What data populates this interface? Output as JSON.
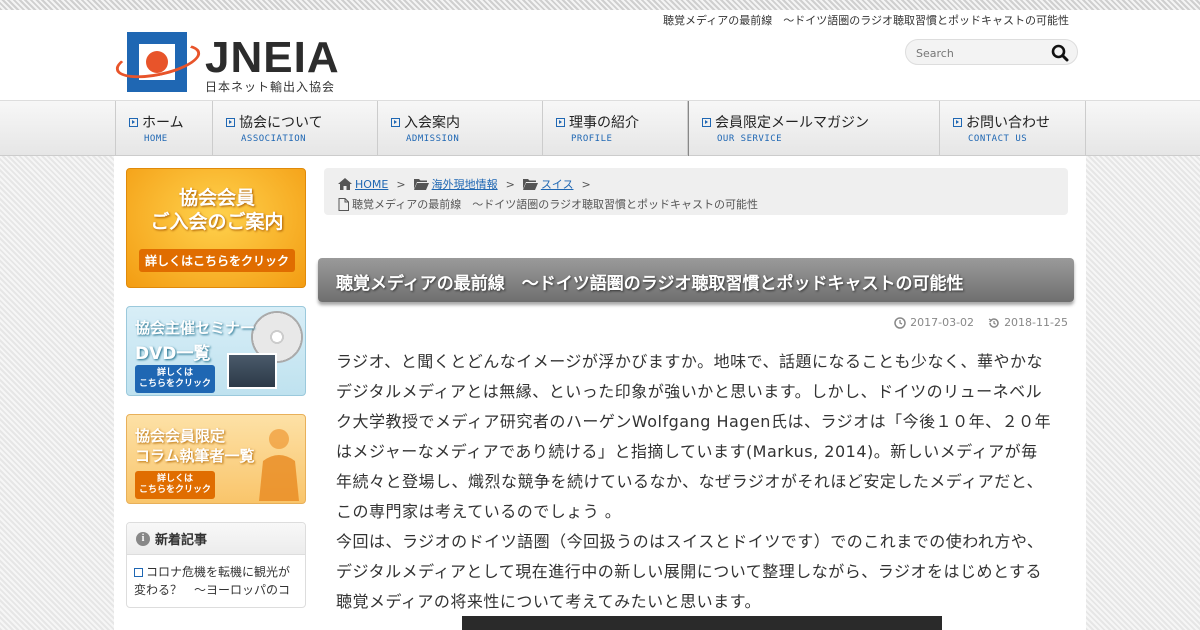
{
  "header": {
    "tagline": "聴覚メディアの最前線　〜ドイツ語圏のラジオ聴取習慣とポッドキャストの可能性",
    "logo_text": "JNEIA",
    "logo_subtitle": "日本ネット輸出入協会",
    "search": {
      "placeholder": "Search"
    }
  },
  "nav": {
    "items": [
      {
        "label": "ホーム",
        "en": "HOME"
      },
      {
        "label": "協会について",
        "en": "ASSOCIATION"
      },
      {
        "label": "入会案内",
        "en": "ADMISSION"
      },
      {
        "label": "理事の紹介",
        "en": "PROFILE"
      },
      {
        "label": "会員限定メールマガジン",
        "en": "OUR SERVICE"
      },
      {
        "label": "お問い合わせ",
        "en": "CONTACT US"
      }
    ]
  },
  "sidebar": {
    "banner1": {
      "line1": "協会会員",
      "line2": "ご入会のご案内",
      "cta": "詳しくはこちらをクリック"
    },
    "banner2": {
      "line1": "協会主催セミナー",
      "line2": "DVD一覧",
      "cta1": "詳しくは",
      "cta2": "こちらをクリック"
    },
    "banner3": {
      "line1": "協会会員限定",
      "line2": "コラム執筆者一覧",
      "cta1": "詳しくは",
      "cta2": "こちらをクリック"
    },
    "widget": {
      "title": "新着記事",
      "item1_line1": "コロナ危機を転機に観光が",
      "item1_line2": "変わる？　〜ヨーロッパのコ"
    }
  },
  "breadcrumb": {
    "home": "HOME",
    "cat1": "海外現地情報",
    "cat2": "スイス",
    "sep": ">",
    "current": "聴覚メディアの最前線　〜ドイツ語圏のラジオ聴取習慣とポッドキャストの可能性"
  },
  "article": {
    "title": "聴覚メディアの最前線　〜ドイツ語圏のラジオ聴取習慣とポッドキャストの可能性",
    "published": "2017-03-02",
    "updated": "2018-11-25",
    "lines": [
      "ラジオ、と聞くとどんなイメージが浮かびますか。地味で、話題になることも少なく、華やかな",
      "デジタルメディアとは無縁、といった印象が強いかと思います。しかし、ドイツのリューネベル",
      "ク大学教授でメディア研究者のハーゲンWolfgang Hagen氏は、ラジオは「今後１０年、２０年",
      "はメジャーなメディアであり続ける」と指摘しています(Markus, 2014)。新しいメディアが毎",
      "年続々と登場し、熾烈な競争を続けているなか、なぜラジオがそれほど安定したメディアだと、",
      "この専門家は考えているのでしょう 。",
      "今回は、ラジオのドイツ語圏（今回扱うのはスイスとドイツです）でのこれまでの使われ方や、",
      "デジタルメディアとして現在進行中の新しい展開について整理しながら、ラジオをはじめとする",
      "聴覚メディアの将来性について考えてみたいと思います。"
    ]
  },
  "colors": {
    "accent": "#1f67b3",
    "logo_orange": "#e8542a",
    "title_bar": "#7f7f7f"
  }
}
